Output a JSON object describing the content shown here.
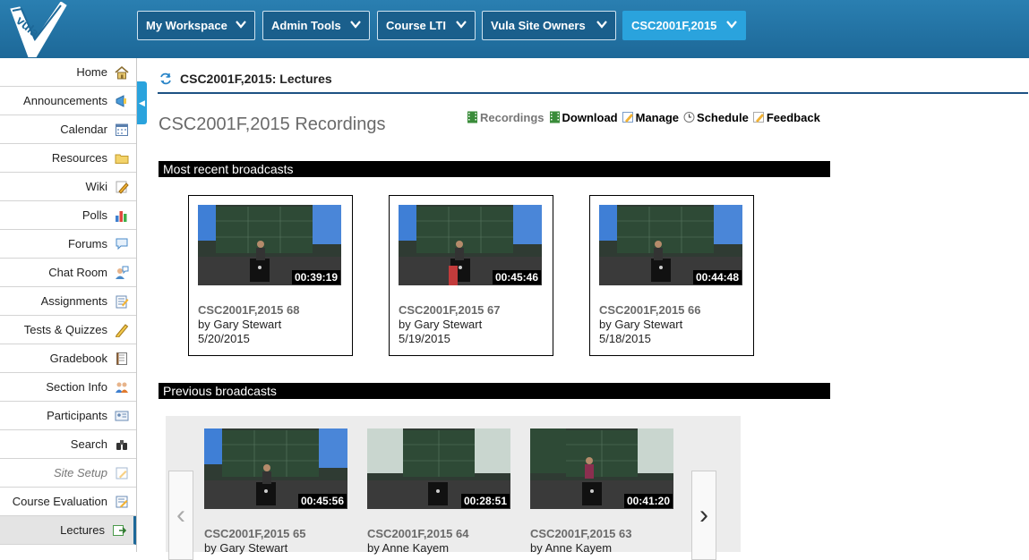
{
  "nav": {
    "buttons": [
      {
        "label": "My Workspace"
      },
      {
        "label": "Admin Tools"
      },
      {
        "label": "Course LTI"
      },
      {
        "label": "Vula Site Owners"
      },
      {
        "label": "CSC2001F,2015"
      }
    ],
    "logo_text": "vula"
  },
  "sidebar": {
    "items": [
      {
        "label": "Home",
        "icon": "home-icon"
      },
      {
        "label": "Announcements",
        "icon": "megaphone-icon"
      },
      {
        "label": "Calendar",
        "icon": "calendar-icon"
      },
      {
        "label": "Resources",
        "icon": "folder-icon"
      },
      {
        "label": "Wiki",
        "icon": "pencil-icon"
      },
      {
        "label": "Polls",
        "icon": "bar-chart-icon"
      },
      {
        "label": "Forums",
        "icon": "speech-bubble-icon"
      },
      {
        "label": "Chat Room",
        "icon": "chat-person-icon"
      },
      {
        "label": "Assignments",
        "icon": "assignment-icon"
      },
      {
        "label": "Tests & Quizzes",
        "icon": "pencil-icon"
      },
      {
        "label": "Gradebook",
        "icon": "gradebook-icon"
      },
      {
        "label": "Section Info",
        "icon": "people-icon"
      },
      {
        "label": "Participants",
        "icon": "id-card-icon"
      },
      {
        "label": "Search",
        "icon": "binoculars-icon"
      },
      {
        "label": "Site Setup",
        "icon": "setup-icon"
      },
      {
        "label": "Course Evaluation",
        "icon": "evaluation-icon"
      },
      {
        "label": "Lectures",
        "icon": "lectures-icon"
      }
    ]
  },
  "page": {
    "title": "CSC2001F,2015: Lectures",
    "heading": "CSC2001F,2015 Recordings",
    "links": [
      {
        "label": "Recordings"
      },
      {
        "label": "Download"
      },
      {
        "label": "Manage"
      },
      {
        "label": "Schedule"
      },
      {
        "label": "Feedback"
      }
    ]
  },
  "recent": {
    "heading": "Most recent broadcasts",
    "items": [
      {
        "title": "CSC2001F,2015 68",
        "by": "by Gary Stewart",
        "date": "5/20/2015",
        "duration": "00:39:19"
      },
      {
        "title": "CSC2001F,2015 67",
        "by": "by Gary Stewart",
        "date": "5/19/2015",
        "duration": "00:45:46"
      },
      {
        "title": "CSC2001F,2015 66",
        "by": "by Gary Stewart",
        "date": "5/18/2015",
        "duration": "00:44:48"
      }
    ]
  },
  "previous": {
    "heading": "Previous broadcasts",
    "prev_arrow": "‹",
    "next_arrow": "›",
    "items": [
      {
        "title": "CSC2001F,2015 65",
        "by": "by Gary Stewart",
        "duration": "00:45:56"
      },
      {
        "title": "CSC2001F,2015 64",
        "by": "by Anne Kayem",
        "duration": "00:28:51"
      },
      {
        "title": "CSC2001F,2015 63",
        "by": "by Anne Kayem",
        "duration": "00:41:20"
      }
    ]
  },
  "colors": {
    "header": "#1d6898",
    "active_tab": "#2aa3dd",
    "section_bar": "#000000"
  }
}
